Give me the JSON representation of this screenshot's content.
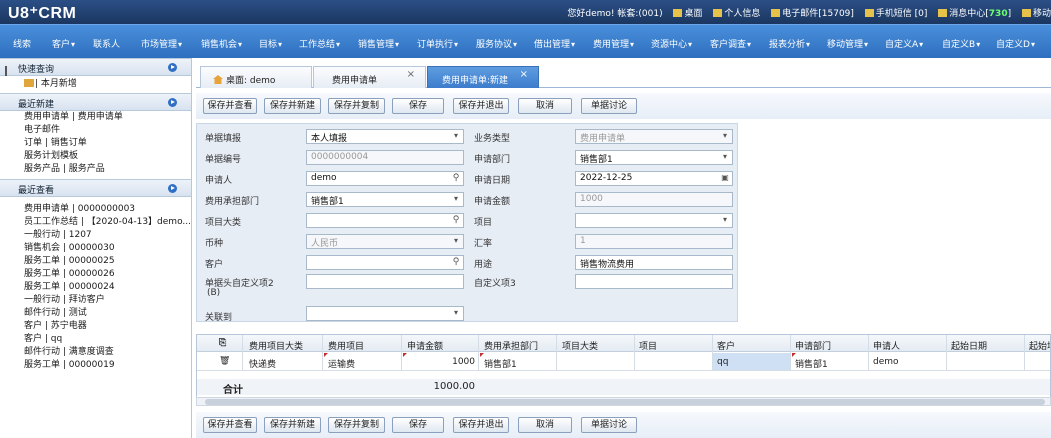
{
  "topbar": {
    "logo": "U8⁺CRM",
    "greeting": "您好demo! 帐套:(001)",
    "desktop": "桌面",
    "personal": "个人信息",
    "email": "电子邮件[15709]",
    "sms": "手机短信 [0]",
    "msg_label": "消息中心[",
    "msg_count": "730",
    "msg_close": "]",
    "mobile": "移动"
  },
  "nav": [
    "线索",
    "客户",
    "联系人",
    "市场管理",
    "销售机会",
    "目标",
    "工作总结",
    "销售管理",
    "订单执行",
    "服务协议",
    "借出管理",
    "费用管理",
    "资源中心",
    "客户调查",
    "报表分析",
    "移动管理",
    "自定义A",
    "自定义B",
    "自定义D"
  ],
  "sidebar": {
    "quick_title": "快速查询",
    "quick_items": [
      "| 本月新增"
    ],
    "recent_new_title": "最近新建",
    "recent_new_items": [
      "费用申请单 | 费用申请单",
      "电子邮件",
      "订单 | 销售订单",
      "服务计划模板",
      "服务产品 | 服务产品"
    ],
    "recent_view_title": "最近查看",
    "recent_view_items": [
      "费用申请单 | 0000000003",
      "员工工作总结 | 【2020-04-13】demo...",
      "一般行动 | 1207",
      "销售机会 | 00000030",
      "服务工单 | 00000025",
      "服务工单 | 00000026",
      "服务工单 | 00000024",
      "一般行动 | 拜访客户",
      "邮件行动 | 测试",
      "客户 | 苏宁电器",
      "客户 | qq",
      "邮件行动 | 满意度调查",
      "服务工单 | 00000019"
    ]
  },
  "tabs": [
    {
      "label": "桌面: demo"
    },
    {
      "label": "费用申请单",
      "close": "×"
    },
    {
      "label": "费用申请单:新建",
      "close": "×"
    }
  ],
  "toolbar": [
    "保存并查看",
    "保存并新建",
    "保存并复制",
    "保存",
    "保存并退出",
    "取消",
    "单据讨论"
  ],
  "form": {
    "bill_fill_label": "单据填报",
    "bill_fill_value": "本人填报",
    "biz_type_label": "业务类型",
    "biz_type_value": "费用申请单",
    "bill_no_label": "单据编号",
    "bill_no_value": "0000000004",
    "apply_dept_label": "申请部门",
    "apply_dept_value": "销售部1",
    "applicant_label": "申请人",
    "applicant_value": "demo",
    "apply_date_label": "申请日期",
    "apply_date_value": "2022-12-25",
    "cost_dept_label": "费用承担部门",
    "cost_dept_value": "销售部1",
    "amount_label": "申请金额",
    "amount_value": "1000",
    "proj_cat_label": "项目大类",
    "proj_cat_value": "",
    "proj_label": "项目",
    "proj_value": "",
    "currency_label": "币种",
    "currency_value": "人民币",
    "rate_label": "汇率",
    "rate_value": "1",
    "customer_label": "客户",
    "customer_value": "",
    "purpose_label": "用途",
    "purpose_value": "销售物流费用",
    "custom2_label": "单据头自定义项2",
    "custom2_sub": "(B)",
    "custom2_value": "",
    "custom3_label": "自定义项3",
    "custom3_value": "",
    "related_label": "关联到",
    "related_value": ""
  },
  "grid": {
    "headers": [
      "费用项目大类",
      "费用项目",
      "申请金额",
      "费用承担部门",
      "项目大类",
      "项目",
      "客户",
      "申请部门",
      "申请人",
      "起始日期",
      "起始地"
    ],
    "row": [
      "快递费",
      "运输费",
      "1000",
      "销售部1",
      "",
      "",
      "qq",
      "销售部1",
      "demo",
      "",
      ""
    ],
    "total_label": "合计",
    "total_value": "1000.00"
  },
  "colors": {
    "nav": "#3a7ccd",
    "topbar": "#1f3d6b",
    "accent": "#2f6fc4"
  }
}
